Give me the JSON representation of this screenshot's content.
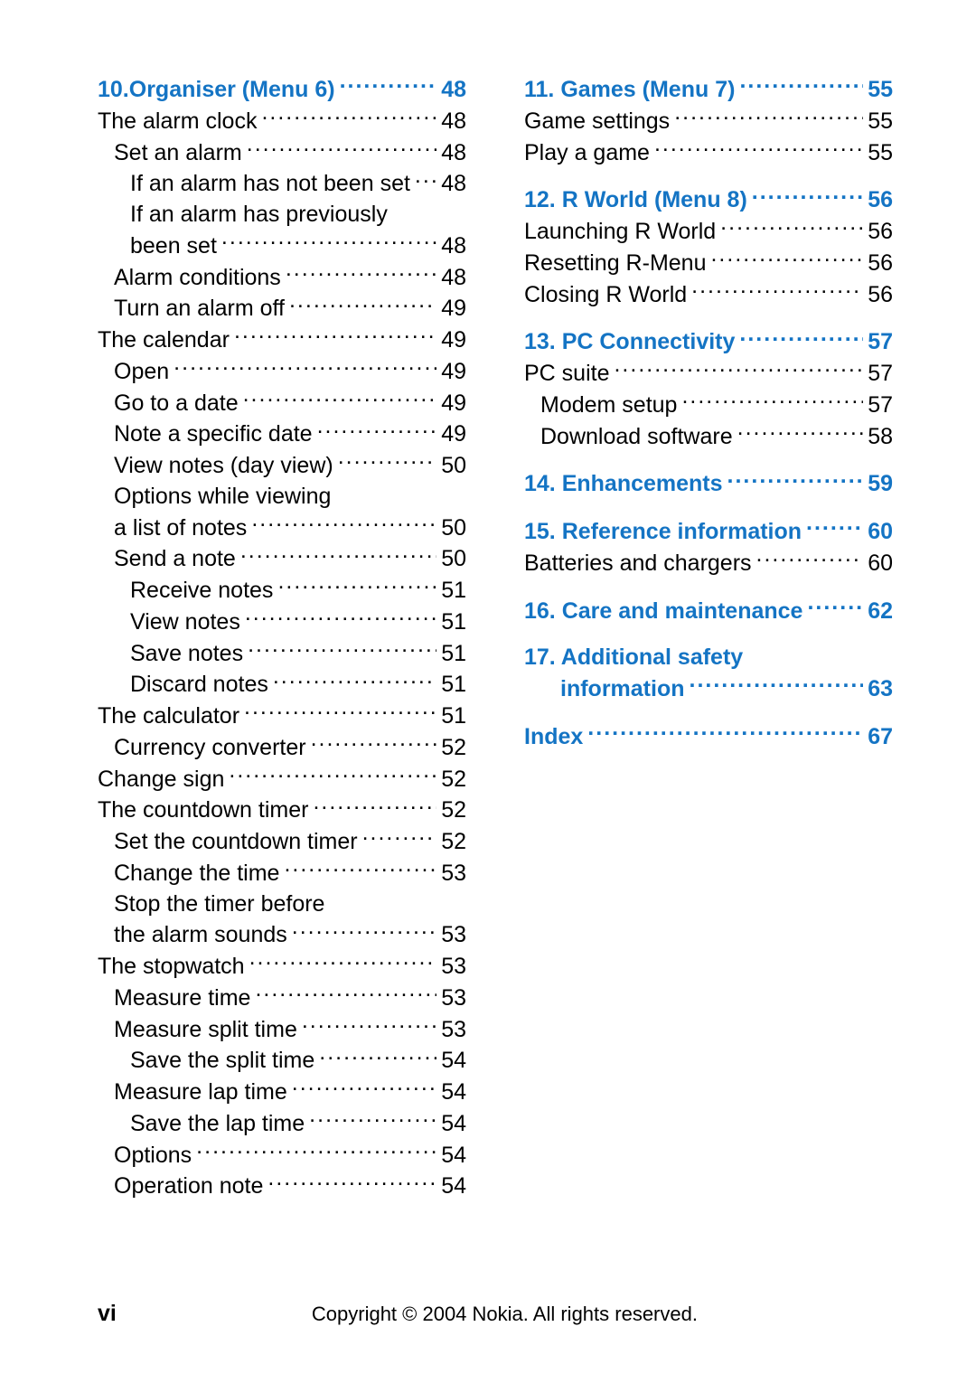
{
  "left": [
    {
      "kind": "heading",
      "indent": 0,
      "label": "10.Organiser (Menu 6)",
      "page": "48",
      "first": true
    },
    {
      "kind": "item",
      "indent": 0,
      "label": "The alarm clock",
      "page": "48"
    },
    {
      "kind": "item",
      "indent": 1,
      "label": "Set an alarm",
      "page": "48"
    },
    {
      "kind": "item",
      "indent": 2,
      "label": "If an alarm has not been set",
      "page": "48"
    },
    {
      "kind": "wrap",
      "indent": 2,
      "label": "If an alarm has previously"
    },
    {
      "kind": "item",
      "indent": 2,
      "label": "been set",
      "page": "48"
    },
    {
      "kind": "item",
      "indent": 1,
      "label": "Alarm conditions",
      "page": "48"
    },
    {
      "kind": "item",
      "indent": 1,
      "label": "Turn an alarm off",
      "page": "49"
    },
    {
      "kind": "item",
      "indent": 0,
      "label": "The calendar",
      "page": "49"
    },
    {
      "kind": "item",
      "indent": 1,
      "label": "Open",
      "page": "49"
    },
    {
      "kind": "item",
      "indent": 1,
      "label": "Go to a date",
      "page": "49"
    },
    {
      "kind": "item",
      "indent": 1,
      "label": "Note a specific date",
      "page": "49"
    },
    {
      "kind": "item",
      "indent": 1,
      "label": "View notes (day view)",
      "page": "50"
    },
    {
      "kind": "wrap",
      "indent": 1,
      "label": "Options while viewing"
    },
    {
      "kind": "item",
      "indent": 1,
      "label": "a list of notes",
      "page": "50"
    },
    {
      "kind": "item",
      "indent": 1,
      "label": "Send a note",
      "page": "50"
    },
    {
      "kind": "item",
      "indent": 2,
      "label": "Receive notes",
      "page": "51"
    },
    {
      "kind": "item",
      "indent": 2,
      "label": "View notes",
      "page": "51"
    },
    {
      "kind": "item",
      "indent": 2,
      "label": "Save notes",
      "page": "51"
    },
    {
      "kind": "item",
      "indent": 2,
      "label": "Discard notes",
      "page": "51"
    },
    {
      "kind": "item",
      "indent": 0,
      "label": "The calculator",
      "page": "51"
    },
    {
      "kind": "item",
      "indent": 1,
      "label": "Currency converter",
      "page": "52"
    },
    {
      "kind": "item",
      "indent": 0,
      "label": "Change sign",
      "page": "52"
    },
    {
      "kind": "item",
      "indent": 0,
      "label": "The countdown timer",
      "page": "52"
    },
    {
      "kind": "item",
      "indent": 1,
      "label": "Set the countdown timer",
      "page": "52"
    },
    {
      "kind": "item",
      "indent": 1,
      "label": "Change the time",
      "page": "53"
    },
    {
      "kind": "wrap",
      "indent": 1,
      "label": "Stop the timer before"
    },
    {
      "kind": "item",
      "indent": 1,
      "label": "the alarm sounds",
      "page": "53"
    },
    {
      "kind": "item",
      "indent": 0,
      "label": "The stopwatch",
      "page": "53"
    },
    {
      "kind": "item",
      "indent": 1,
      "label": "Measure time",
      "page": "53"
    },
    {
      "kind": "item",
      "indent": 1,
      "label": "Measure split time",
      "page": "53"
    },
    {
      "kind": "item",
      "indent": 2,
      "label": "Save the split time",
      "page": "54"
    },
    {
      "kind": "item",
      "indent": 1,
      "label": "Measure lap time",
      "page": "54"
    },
    {
      "kind": "item",
      "indent": 2,
      "label": "Save the lap time",
      "page": "54"
    },
    {
      "kind": "item",
      "indent": 1,
      "label": "Options",
      "page": "54"
    },
    {
      "kind": "item",
      "indent": 1,
      "label": "Operation note",
      "page": "54"
    }
  ],
  "right": [
    {
      "kind": "heading",
      "indent": 0,
      "label": "11. Games (Menu 7)",
      "page": "55",
      "first": true
    },
    {
      "kind": "item",
      "indent": 0,
      "label": "Game settings",
      "page": "55"
    },
    {
      "kind": "item",
      "indent": 0,
      "label": "Play a game",
      "page": "55"
    },
    {
      "kind": "heading",
      "indent": 0,
      "label": "12. R World (Menu 8)",
      "page": "56"
    },
    {
      "kind": "item",
      "indent": 0,
      "label": "Launching R World",
      "page": "56"
    },
    {
      "kind": "item",
      "indent": 0,
      "label": "Resetting R-Menu",
      "page": "56"
    },
    {
      "kind": "item",
      "indent": 0,
      "label": "Closing R World",
      "page": "56"
    },
    {
      "kind": "heading",
      "indent": 0,
      "label": "13. PC Connectivity",
      "page": "57"
    },
    {
      "kind": "item",
      "indent": 0,
      "label": "PC suite",
      "page": "57"
    },
    {
      "kind": "item",
      "indent": 1,
      "label": "Modem setup",
      "page": "57"
    },
    {
      "kind": "item",
      "indent": 1,
      "label": "Download software",
      "page": "58"
    },
    {
      "kind": "heading",
      "indent": 0,
      "label": "14. Enhancements",
      "page": "59"
    },
    {
      "kind": "heading",
      "indent": 0,
      "label": "15. Reference information",
      "page": "60"
    },
    {
      "kind": "item",
      "indent": 0,
      "label": "Batteries and chargers",
      "page": "60"
    },
    {
      "kind": "heading",
      "indent": 0,
      "label": "16. Care and maintenance",
      "page": "62"
    },
    {
      "kind": "heading-wrap",
      "indent": 0,
      "label": "17. Additional safety"
    },
    {
      "kind": "heading-cont",
      "indent": 0,
      "label": "information",
      "page": "63"
    },
    {
      "kind": "heading",
      "indent": 0,
      "label": "Index",
      "page": "67"
    }
  ],
  "footer": {
    "page_marker": "vi",
    "copyright": "Copyright © 2004 Nokia. All rights reserved."
  }
}
